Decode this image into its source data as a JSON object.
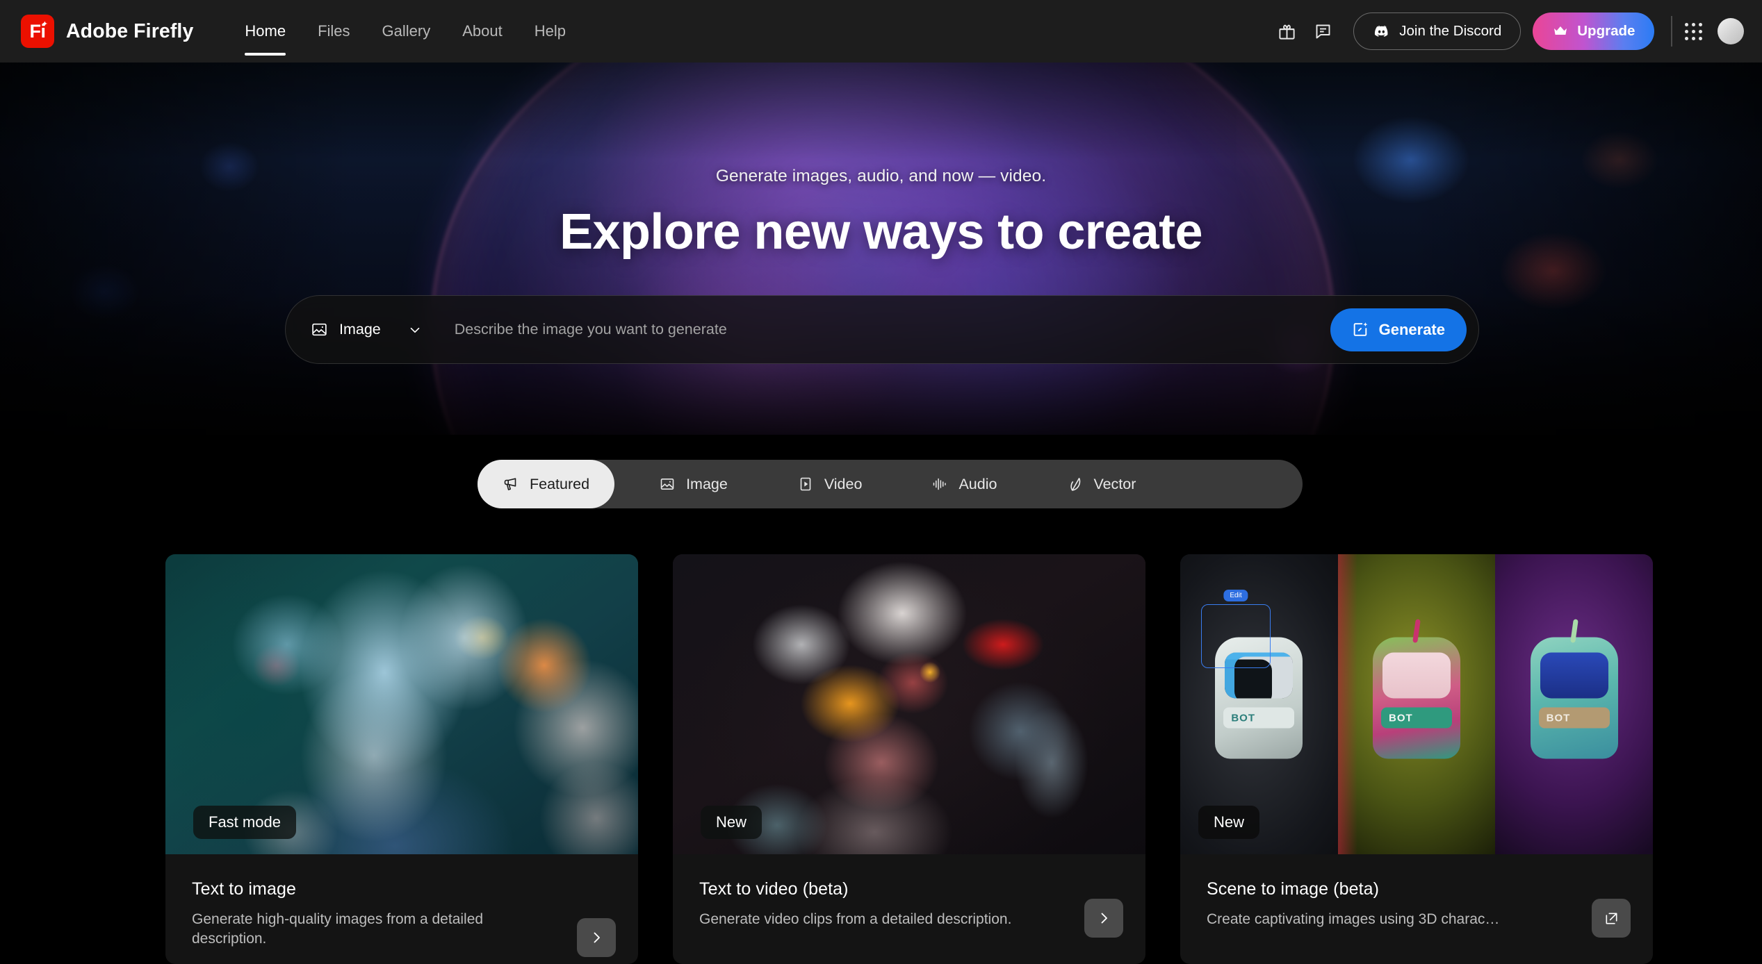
{
  "topbar": {
    "brand": {
      "logo_text": "Fi",
      "name": "Adobe Firefly"
    },
    "nav": [
      {
        "label": "Home",
        "active": true
      },
      {
        "label": "Files",
        "active": false
      },
      {
        "label": "Gallery",
        "active": false
      },
      {
        "label": "About",
        "active": false
      },
      {
        "label": "Help",
        "active": false
      }
    ],
    "gift_icon": "gift-icon",
    "feedback_icon": "feedback-icon",
    "discord_label": "Join the Discord",
    "discord_icon": "discord-icon",
    "upgrade_label": "Upgrade",
    "upgrade_icon": "crown-icon",
    "app_grid_icon": "app-grid-icon",
    "avatar_icon": "user-avatar"
  },
  "hero": {
    "eyebrow": "Generate images, audio, and now — video.",
    "title": "Explore new ways to create"
  },
  "prompt": {
    "type_label": "Image",
    "type_icon": "image-icon",
    "chevron_icon": "chevron-down-icon",
    "placeholder": "Describe the image you want to generate",
    "value": "",
    "generate_label": "Generate",
    "generate_icon": "generate-sparkle-icon",
    "generate_color": "#1473e6"
  },
  "tabs": [
    {
      "label": "Featured",
      "icon": "megaphone-icon",
      "active": true
    },
    {
      "label": "Image",
      "icon": "image-icon",
      "active": false
    },
    {
      "label": "Video",
      "icon": "video-play-icon",
      "active": false
    },
    {
      "label": "Audio",
      "icon": "audio-waveform-icon",
      "active": false
    },
    {
      "label": "Vector",
      "icon": "vector-pen-icon",
      "active": false
    }
  ],
  "cards": [
    {
      "badge": "Fast mode",
      "title": "Text to image",
      "desc": "Generate high-quality images from a detailed description.",
      "action_icon": "chevron-right-icon"
    },
    {
      "badge": "New",
      "title": "Text to video (beta)",
      "desc": "Generate video clips from a detailed description.",
      "action_icon": "chevron-right-icon"
    },
    {
      "badge": "New",
      "title": "Scene to image (beta)",
      "desc": "Create captivating images using 3D charac…",
      "action_icon": "external-link-icon"
    }
  ],
  "colors": {
    "topbar_bg": "#1d1d1d",
    "page_bg": "#000000",
    "accent_blue": "#1473e6",
    "brand_red": "#eb1000",
    "tabstrip_bg": "#3a3a3a",
    "tab_active_bg": "#ebebeb"
  }
}
